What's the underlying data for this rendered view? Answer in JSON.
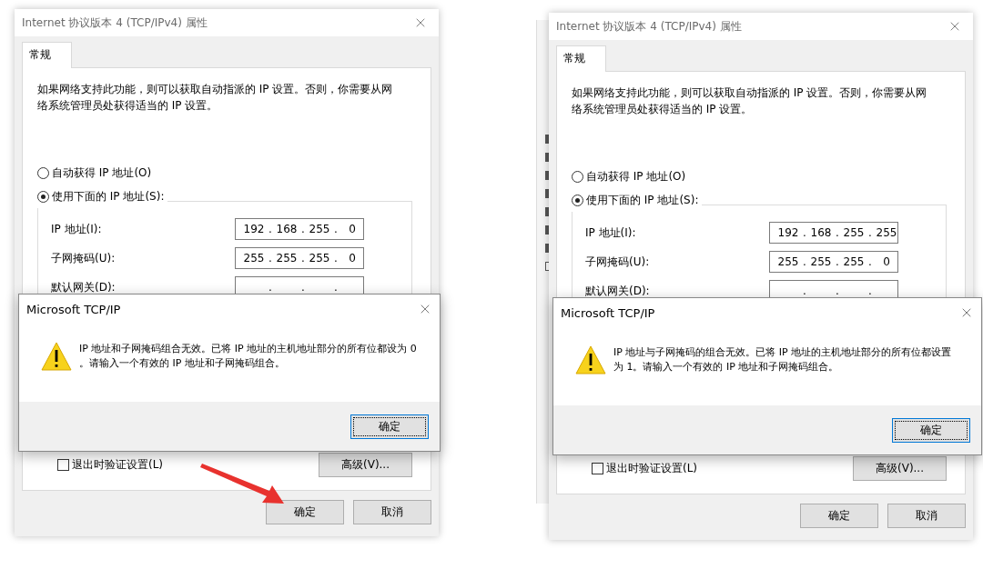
{
  "panels": [
    {
      "pointer_arrow": true,
      "properties_window": {
        "title": "Internet 协议版本 4 (TCP/IPv4) 属性",
        "tabs": [
          {
            "label": "常规",
            "selected": true
          }
        ],
        "description": [
          "如果网络支持此功能，则可以获取自动指派的 IP 设置。否则，你需要从网",
          "络系统管理员处获得适当的 IP 设置。"
        ],
        "radios": [
          {
            "label": "自动获得 IP 地址(O)",
            "selected": false
          },
          {
            "label": "使用下面的 IP 地址(S):",
            "selected": true
          }
        ],
        "separator": ".",
        "fields": [
          {
            "label": "IP 地址(I):",
            "octets": [
              "192",
              "168",
              "255",
              "0"
            ]
          },
          {
            "label": "子网掩码(U):",
            "octets": [
              "255",
              "255",
              "255",
              "0"
            ]
          },
          {
            "label": "默认网关(D):"
          }
        ],
        "checkbox": {
          "label": "退出时验证设置(L)",
          "checked": false
        },
        "advanced_button": "高级(V)...",
        "buttons": [
          "确定",
          "取消"
        ]
      },
      "message_box": {
        "title": "Microsoft TCP/IP",
        "message": [
          "IP 地址和子网掩码组合无效。已将 IP 地址的主机地址部分的所有位都设为 0",
          "。请输入一个有效的 IP 地址和子网掩码组合。"
        ],
        "button": "确定"
      }
    },
    {
      "behind_window": {
        "checkboxes": [
          {
            "checked": true
          },
          {
            "checked": true
          },
          {
            "checked": true
          },
          {
            "checked": true
          },
          {
            "checked": true
          },
          {
            "checked": true
          },
          {
            "checked": true
          },
          {
            "checked": false
          }
        ]
      },
      "pointer_arrow": false,
      "properties_window": {
        "title": "Internet 协议版本 4 (TCP/IPv4) 属性",
        "tabs": [
          {
            "label": "常规",
            "selected": true
          }
        ],
        "description": [
          "如果网络支持此功能，则可以获取自动指派的 IP 设置。否则，你需要从网",
          "络系统管理员处获得适当的 IP 设置。"
        ],
        "radios": [
          {
            "label": "自动获得 IP 地址(O)",
            "selected": false
          },
          {
            "label": "使用下面的 IP 地址(S):",
            "selected": true
          }
        ],
        "separator": ".",
        "fields": [
          {
            "label": "IP 地址(I):",
            "octets": [
              "192",
              "168",
              "255",
              "255"
            ]
          },
          {
            "label": "子网掩码(U):",
            "octets": [
              "255",
              "255",
              "255",
              "0"
            ]
          },
          {
            "label": "默认网关(D):"
          }
        ],
        "checkbox": {
          "label": "退出时验证设置(L)",
          "checked": false
        },
        "advanced_button": "高级(V)...",
        "buttons": [
          "确定",
          "取消"
        ]
      },
      "message_box": {
        "title": "Microsoft TCP/IP",
        "message": [
          "IP 地址与子网掩码的组合无效。已将 IP 地址的主机地址部分的所有位都设置",
          "为 1。请输入一个有效的 IP 地址和子网掩码组合。"
        ],
        "button": "确定"
      }
    }
  ]
}
